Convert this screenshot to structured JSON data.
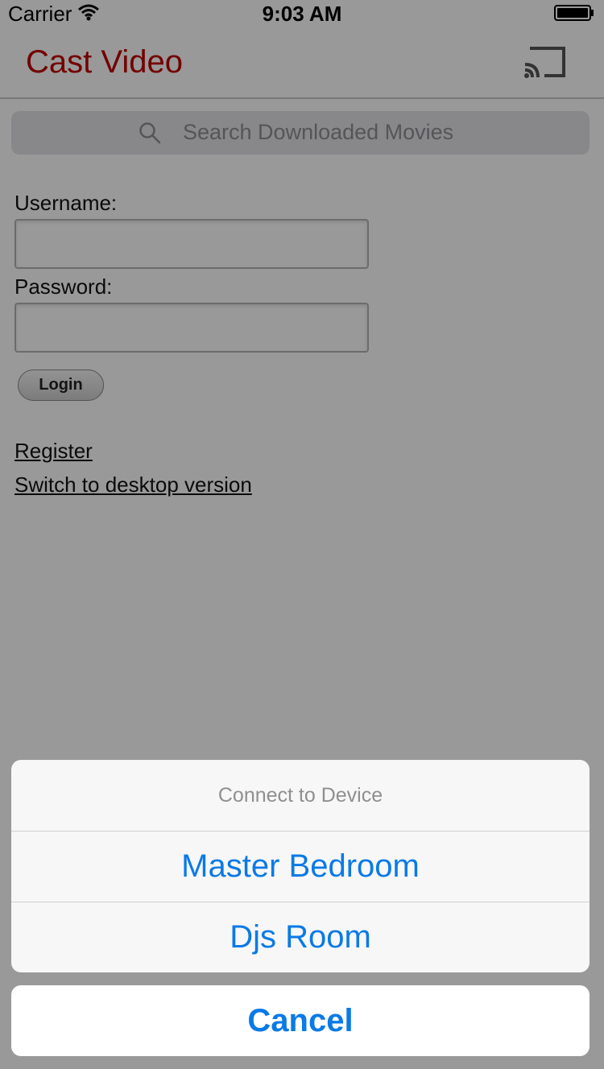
{
  "status_bar": {
    "carrier": "Carrier",
    "time": "9:03 AM",
    "wifi_icon": "wifi-icon",
    "battery_icon": "battery-full-icon"
  },
  "nav": {
    "title": "Cast Video",
    "title_color": "#c00000",
    "cast_icon": "cast-icon"
  },
  "search": {
    "placeholder": "Search Downloaded Movies",
    "icon": "search-icon"
  },
  "form": {
    "username_label": "Username:",
    "username_value": "",
    "password_label": "Password:",
    "password_value": "",
    "login_label": "Login"
  },
  "links": {
    "register": "Register",
    "desktop": "Switch to desktop version"
  },
  "action_sheet": {
    "title": "Connect to Device",
    "options": [
      {
        "label": "Master Bedroom"
      },
      {
        "label": "Djs Room"
      }
    ],
    "cancel_label": "Cancel",
    "accent_color": "#0a7ae6"
  }
}
